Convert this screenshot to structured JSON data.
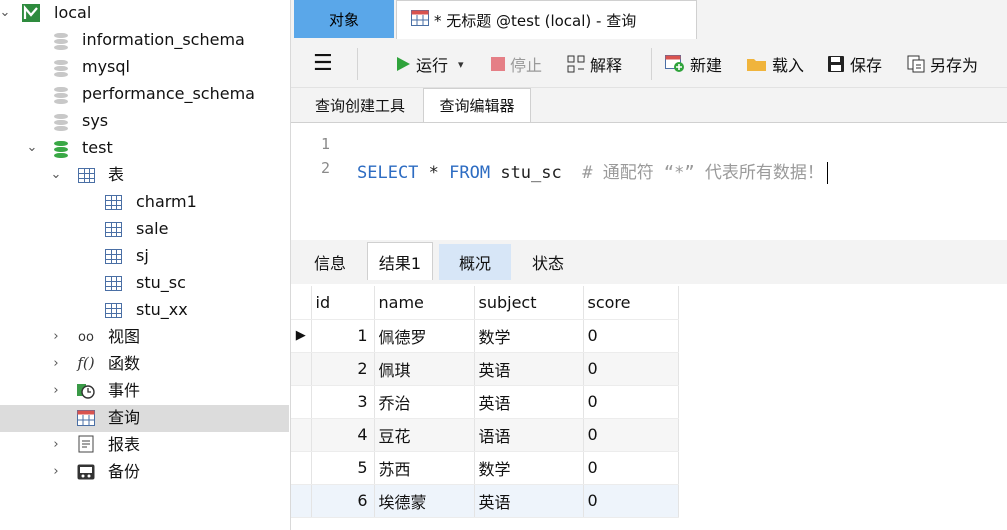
{
  "tree": {
    "connection": "local",
    "databases": [
      "information_schema",
      "mysql",
      "performance_schema",
      "sys"
    ],
    "open_db": "test",
    "tables_label": "表",
    "tables": [
      "charm1",
      "sale",
      "sj",
      "stu_sc",
      "stu_xx"
    ],
    "views_label": "视图",
    "functions_label": "函数",
    "events_label": "事件",
    "queries_label": "查询",
    "reports_label": "报表",
    "backups_label": "备份"
  },
  "tabs": {
    "objects_label": "对象",
    "query_tab_label": "* 无标题 @test (local) - 查询"
  },
  "toolbar": {
    "run": "运行",
    "stop": "停止",
    "explain": "解释",
    "new": "新建",
    "load": "载入",
    "save": "保存",
    "save_as": "另存为"
  },
  "subtabs": {
    "builder": "查询创建工具",
    "editor": "查询编辑器"
  },
  "editor": {
    "line1": "1",
    "line2": "2",
    "kw_select": "SELECT",
    "star": " * ",
    "kw_from": "FROM",
    "table": " stu_sc  ",
    "comment": "# 通配符 “*” 代表所有数据！"
  },
  "result_tabs": {
    "info": "信息",
    "result1": "结果1",
    "overview": "概况",
    "status": "状态"
  },
  "result": {
    "columns": [
      "id",
      "name",
      "subject",
      "score"
    ],
    "rows": [
      [
        "1",
        "佩德罗",
        "数学",
        "0"
      ],
      [
        "2",
        "佩琪",
        "英语",
        "0"
      ],
      [
        "3",
        "乔治",
        "英语",
        "0"
      ],
      [
        "4",
        "豆花",
        "语语",
        "0"
      ],
      [
        "5",
        "苏西",
        "数学",
        "0"
      ],
      [
        "6",
        "埃德蒙",
        "英语",
        "0"
      ]
    ]
  },
  "colors": {
    "accent": "#5aa7e9",
    "run_green": "#2fa33b",
    "keyword_blue": "#2d6cc2",
    "comment_gray": "#9a9a9a"
  }
}
